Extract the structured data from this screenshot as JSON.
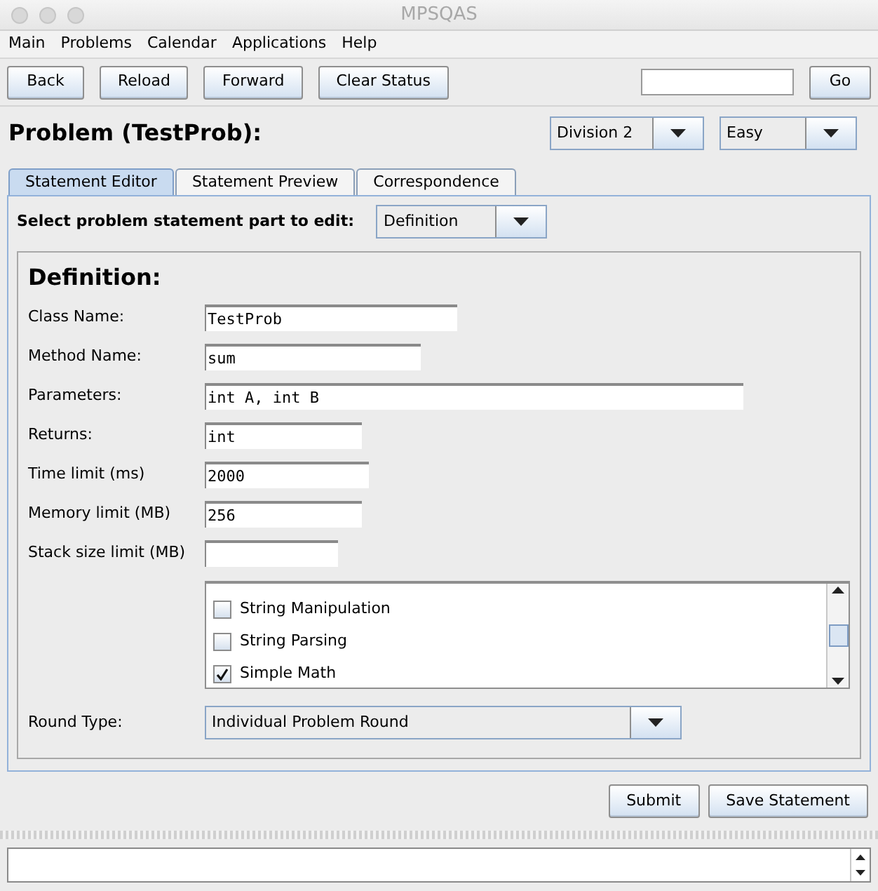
{
  "window": {
    "title": "MPSQAS"
  },
  "menu": [
    "Main",
    "Problems",
    "Calendar",
    "Applications",
    "Help"
  ],
  "toolbar": {
    "buttons": [
      "Back",
      "Reload",
      "Forward",
      "Clear Status"
    ],
    "go": "Go"
  },
  "header": {
    "title": "Problem (TestProb):",
    "division": "Division 2",
    "difficulty": "Easy"
  },
  "tabs": [
    {
      "label": "Statement Editor",
      "selected": true
    },
    {
      "label": "Statement Preview",
      "selected": false
    },
    {
      "label": "Correspondence",
      "selected": false
    }
  ],
  "part_selector": {
    "label": "Select problem statement part to edit:",
    "value": "Definition"
  },
  "definition": {
    "heading": "Definition:",
    "fields": [
      {
        "label": "Class Name:",
        "value": "TestProb"
      },
      {
        "label": "Method Name:",
        "value": "sum"
      },
      {
        "label": "Parameters:",
        "value": "int A, int B"
      },
      {
        "label": "Returns:",
        "value": "int"
      },
      {
        "label": "Time limit (ms)",
        "value": "2000"
      },
      {
        "label": "Memory limit (MB)",
        "value": "256"
      },
      {
        "label": "Stack size limit (MB)"
      }
    ],
    "categories": [
      {
        "label": "String Manipulation",
        "checked": false
      },
      {
        "label": "String Parsing",
        "checked": false
      },
      {
        "label": "Simple Math",
        "checked": true
      }
    ],
    "round_type": {
      "label": "Round Type:",
      "value": "Individual Problem Round"
    }
  },
  "actions": [
    "Submit",
    "Save Statement"
  ]
}
